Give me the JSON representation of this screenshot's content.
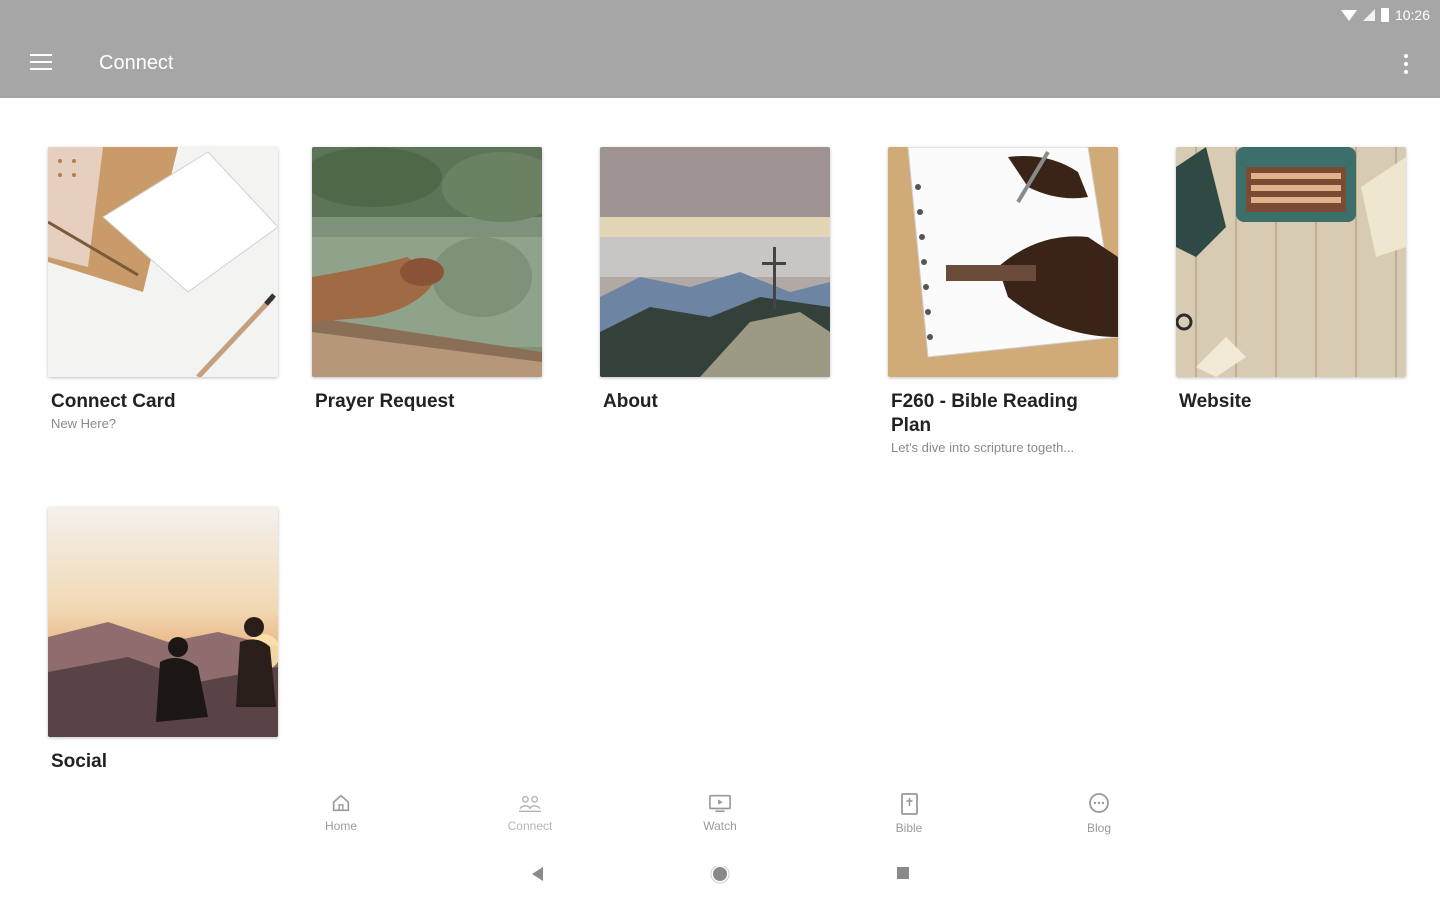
{
  "status_bar": {
    "time": "10:26",
    "icons": [
      "wifi-icon",
      "signal-icon",
      "battery-icon"
    ]
  },
  "app_bar": {
    "title": "Connect",
    "menu_icon": "hamburger-menu-icon",
    "overflow_icon": "more-vert-icon"
  },
  "colors": {
    "app_bar": "#a6a6a6",
    "nav_label": "#9a9a9a",
    "card_title": "#222222",
    "card_subtitle": "#8a8a8a"
  },
  "cards": [
    {
      "title": "Connect Card",
      "subtitle": "New Here?",
      "image": "notecards-and-pencil-photo"
    },
    {
      "title": "Prayer Request",
      "subtitle": "",
      "image": "praying-hands-photo"
    },
    {
      "title": "About",
      "subtitle": "",
      "image": "mountain-cross-photo"
    },
    {
      "title": "F260 - Bible Reading Plan",
      "subtitle": "Let's dive into scripture togeth...",
      "image": "writing-in-notebook-photo"
    },
    {
      "title": "Website",
      "subtitle": "",
      "image": "typewriter-desk-photo"
    },
    {
      "title": "Social",
      "subtitle": "",
      "image": "sunset-friends-photo"
    }
  ],
  "bottom_nav": [
    {
      "label": "Home",
      "icon": "home-icon"
    },
    {
      "label": "Connect",
      "icon": "people-icon"
    },
    {
      "label": "Watch",
      "icon": "tv-icon"
    },
    {
      "label": "Bible",
      "icon": "bible-icon"
    },
    {
      "label": "Blog",
      "icon": "chat-bubble-icon"
    }
  ],
  "system_nav": [
    "back-icon",
    "home-circle-icon",
    "recents-icon"
  ]
}
